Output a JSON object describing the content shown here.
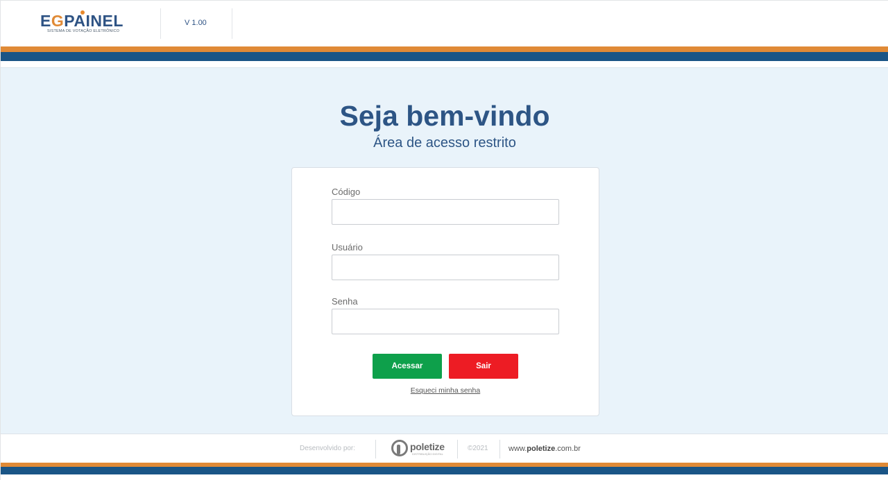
{
  "header": {
    "logo_eg": "EG",
    "logo_painel": "PAINEL",
    "logo_tagline": "SISTEMA DE VOTAÇÃO ELETRÔNICO",
    "version": "V 1.00"
  },
  "colors": {
    "brand_blue": "#2d5585",
    "brand_orange": "#e08a36",
    "stripe_blue": "#1a5586",
    "background": "#e9f3fa",
    "button_access": "#0ea04b",
    "button_exit": "#ed1c24"
  },
  "main": {
    "title": "Seja bem-vindo",
    "subtitle": "Área de acesso restrito"
  },
  "form": {
    "codigo_label": "Código",
    "codigo_value": "",
    "usuario_label": "Usuário",
    "usuario_value": "",
    "senha_label": "Senha",
    "senha_value": "",
    "acessar_label": "Acessar",
    "sair_label": "Sair",
    "forgot_label": "Esqueci minha senha"
  },
  "footer": {
    "developed_by": "Desenvolvido por:",
    "company_name": "poletize",
    "company_tagline": "DISTRIBUIÇÃO DIGITAL",
    "copyright": "©2021",
    "website_prefix": "www.",
    "website_name": "poletize",
    "website_suffix": ".com.br"
  }
}
